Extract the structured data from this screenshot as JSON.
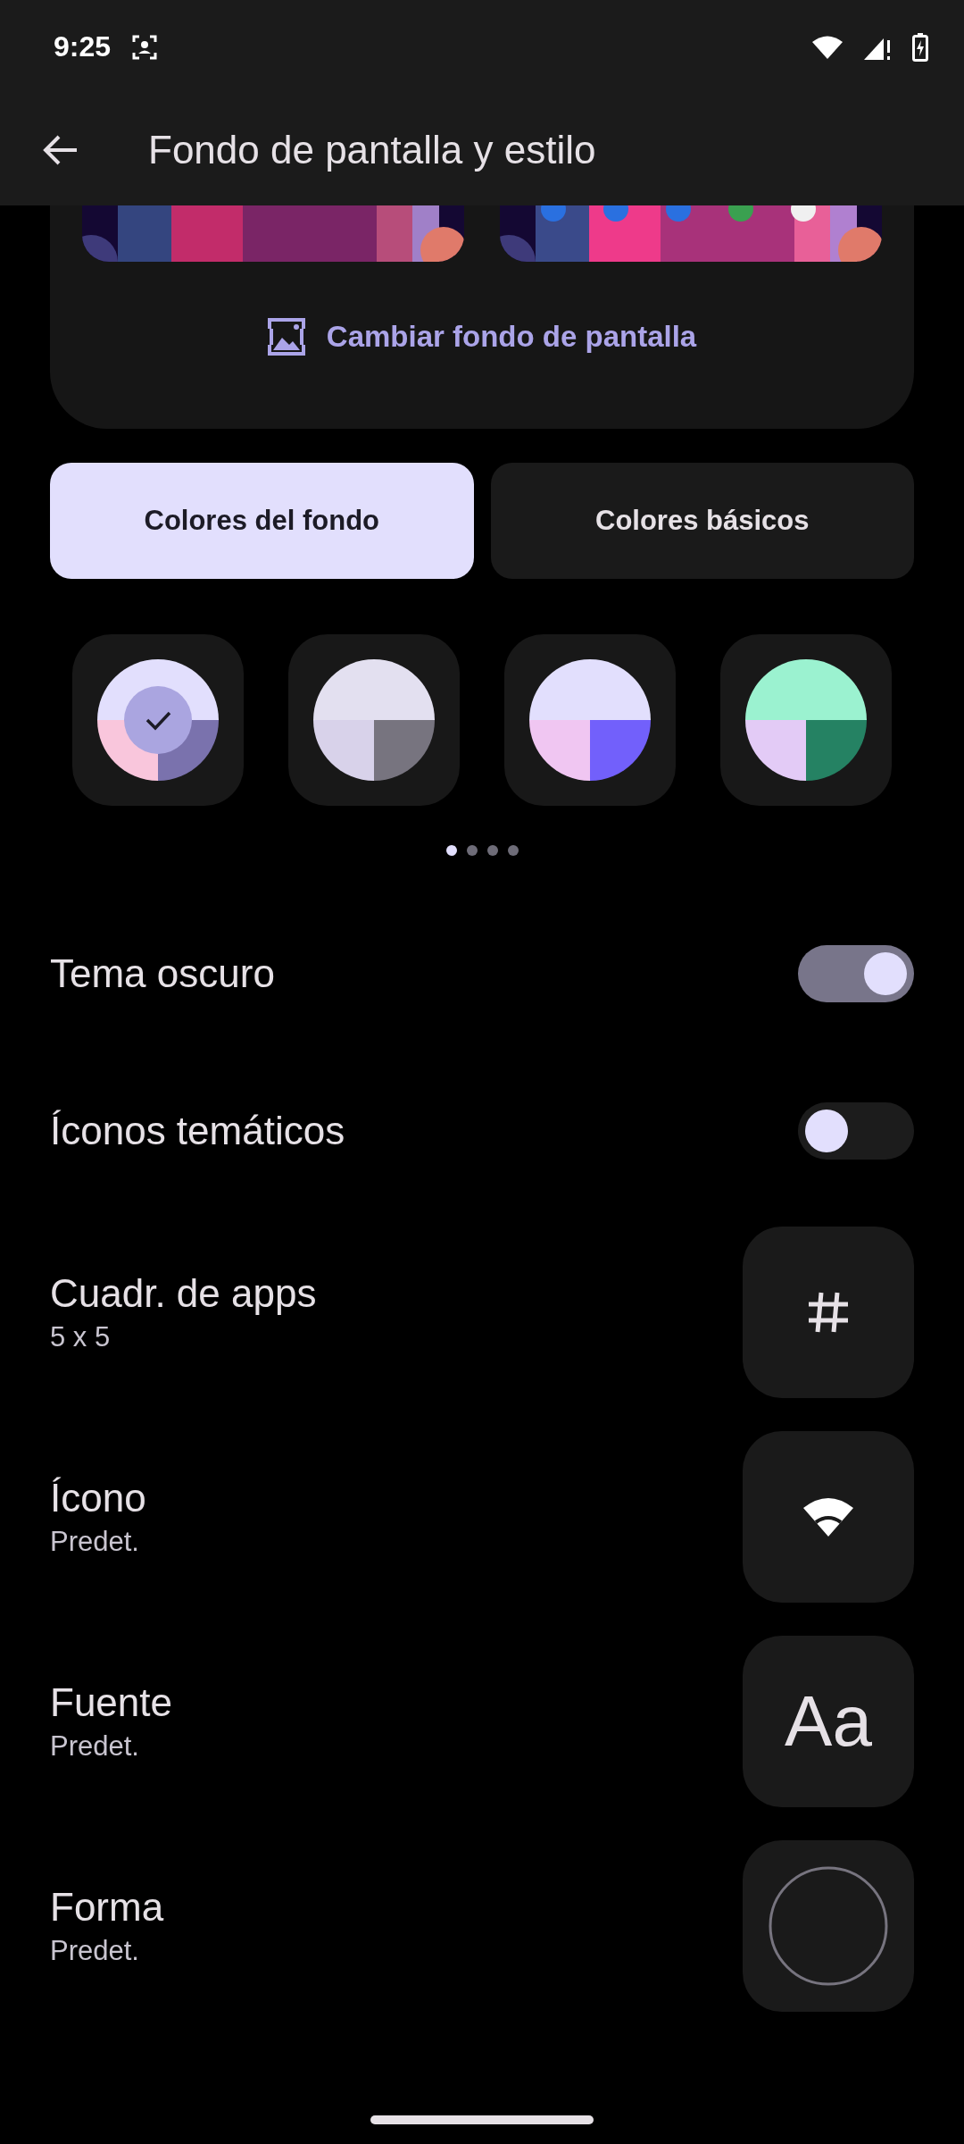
{
  "status_bar": {
    "time": "9:25"
  },
  "app_bar": {
    "title": "Fondo de pantalla y estilo"
  },
  "wallpaper_card": {
    "change_button": "Cambiar fondo de pantalla"
  },
  "tabs": [
    {
      "label": "Colores del fondo",
      "selected": true
    },
    {
      "label": "Colores básicos",
      "selected": false
    }
  ],
  "swatches": [
    {
      "selected": true,
      "parts": [
        {
          "color": "#e2dffd"
        },
        {
          "color": "#f9c6dc"
        },
        {
          "color": "#7a72ad"
        }
      ]
    },
    {
      "selected": false,
      "parts": [
        {
          "color": "#e3e0f0"
        },
        {
          "color": "#d8d2ea"
        },
        {
          "color": "#77747f"
        }
      ]
    },
    {
      "selected": false,
      "parts": [
        {
          "color": "#e2dffd"
        },
        {
          "color": "#f0c6f2"
        },
        {
          "color": "#7260fb"
        }
      ]
    },
    {
      "selected": false,
      "parts": [
        {
          "color": "#9bf2d0"
        },
        {
          "color": "#e3cbf6"
        },
        {
          "color": "#258263"
        }
      ]
    }
  ],
  "page_dots": [
    {
      "selected": true
    },
    {
      "selected": false
    },
    {
      "selected": false
    },
    {
      "selected": false
    }
  ],
  "settings": [
    {
      "kind": "toggle",
      "title": "Tema oscuro",
      "on": true
    },
    {
      "kind": "toggle",
      "title": "Íconos temáticos",
      "on": false
    },
    {
      "kind": "tile",
      "title": "Cuadr. de apps",
      "subtitle": "5 x 5",
      "preview": {
        "kind": "grid"
      }
    },
    {
      "kind": "tile",
      "title": "Ícono",
      "subtitle": "Predet.",
      "preview": {
        "kind": "wifi"
      }
    },
    {
      "kind": "tile",
      "title": "Fuente",
      "subtitle": "Predet.",
      "preview": {
        "kind": "font",
        "text": "Aa"
      }
    },
    {
      "kind": "tile",
      "title": "Forma",
      "subtitle": "Predet.",
      "preview": {
        "kind": "shape"
      }
    }
  ]
}
